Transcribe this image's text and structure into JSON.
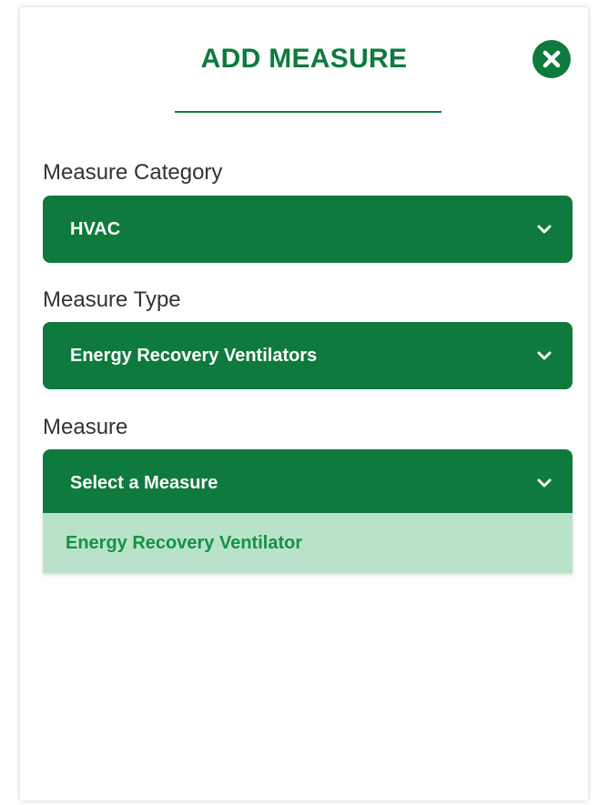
{
  "modal": {
    "title": "ADD MEASURE",
    "close_icon": "close-circle-icon"
  },
  "fields": {
    "category": {
      "label": "Measure Category",
      "value": "HVAC"
    },
    "type": {
      "label": "Measure Type",
      "value": "Energy Recovery Ventilators"
    },
    "measure": {
      "label": "Measure",
      "placeholder": "Select a Measure",
      "options": [
        "Energy Recovery Ventilator"
      ]
    }
  },
  "colors": {
    "brand_green": "#0f7a3d",
    "dropdown_bg": "#b9e3c9",
    "option_text": "#159147"
  }
}
